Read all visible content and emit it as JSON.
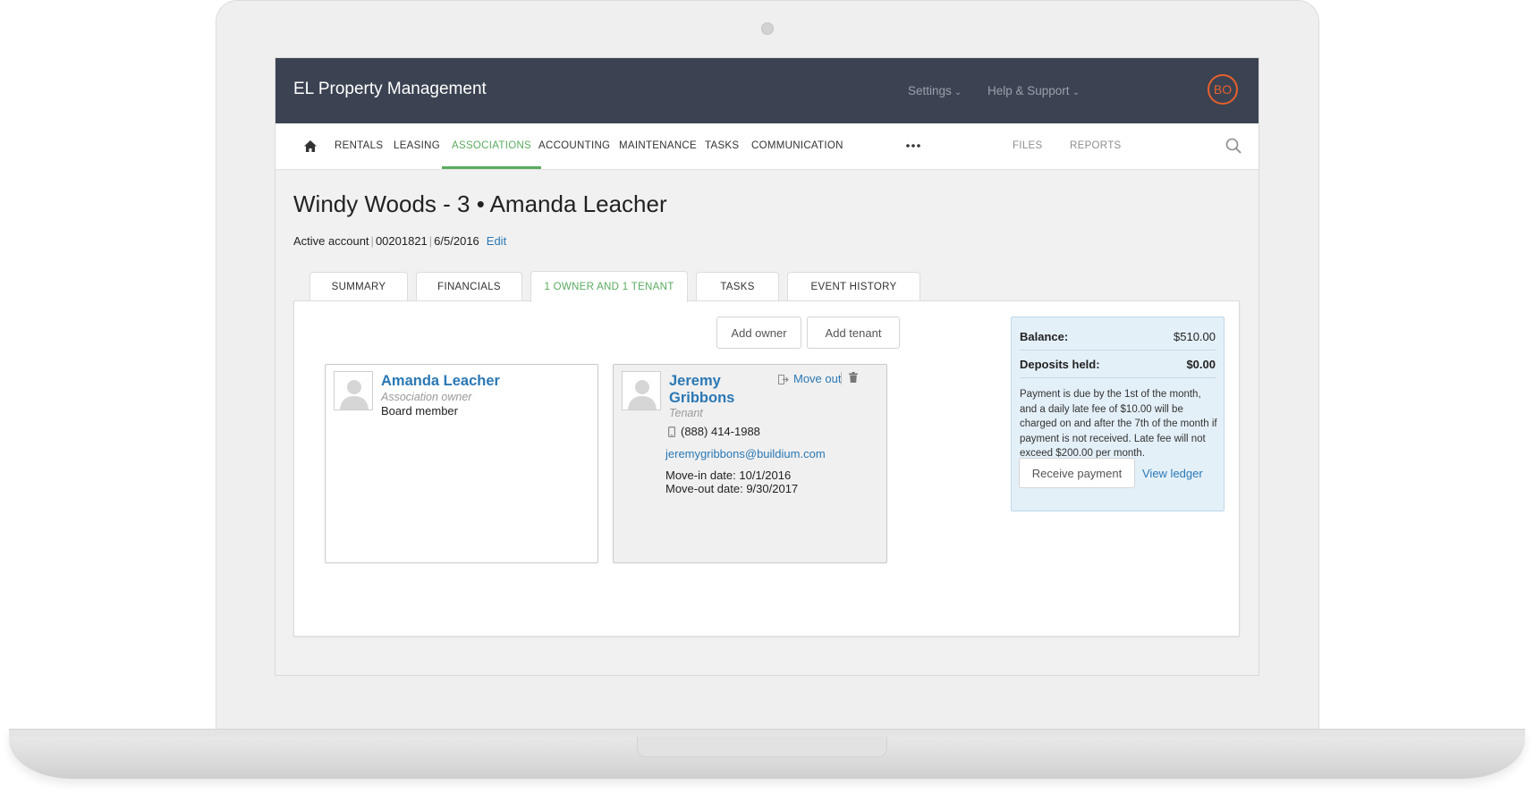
{
  "app": {
    "title": "EL Property Management",
    "avatar_initials": "BO"
  },
  "header_menu": {
    "settings": "Settings",
    "help": "Help & Support"
  },
  "nav": {
    "items": [
      "RENTALS",
      "LEASING",
      "ASSOCIATIONS",
      "ACCOUNTING",
      "MAINTENANCE",
      "TASKS",
      "COMMUNICATION"
    ],
    "active": "ASSOCIATIONS",
    "right_items": [
      "FILES",
      "REPORTS"
    ]
  },
  "page": {
    "title": "Windy Woods - 3 • Amanda Leacher",
    "account_status": "Active account",
    "account_number": "00201821",
    "date": "6/5/2016",
    "edit_label": "Edit"
  },
  "tabs": [
    "SUMMARY",
    "FINANCIALS",
    "1 OWNER AND 1 TENANT",
    "TASKS",
    "EVENT HISTORY"
  ],
  "actions": {
    "add_owner": "Add owner",
    "add_tenant": "Add tenant"
  },
  "owner": {
    "name": "Amanda Leacher",
    "role": "Association owner",
    "position": "Board member"
  },
  "tenant": {
    "first_name": "Jeremy",
    "last_name": "Gribbons",
    "role": "Tenant",
    "move_out_label": "Move out",
    "phone": "(888) 414-1988",
    "email": "jeremygribbons@buildium.com",
    "move_in": "Move-in date: 10/1/2016",
    "move_out": "Move-out date: 9/30/2017"
  },
  "balance": {
    "balance_label": "Balance:",
    "balance_value": "$510.00",
    "deposits_label": "Deposits held:",
    "deposits_value": "$0.00",
    "note": "Payment is due by the 1st of the month, and a daily late fee of $10.00 will be charged on and after the 7th of the month if payment is not received. Late fee will not exceed $200.00 per month.",
    "receive_payment": "Receive payment",
    "view_ledger": "View ledger"
  },
  "colors": {
    "header_bg": "#3b4352",
    "accent_green": "#5aab5f",
    "link_blue": "#2a78b5",
    "avatar_orange": "#e9602d"
  }
}
